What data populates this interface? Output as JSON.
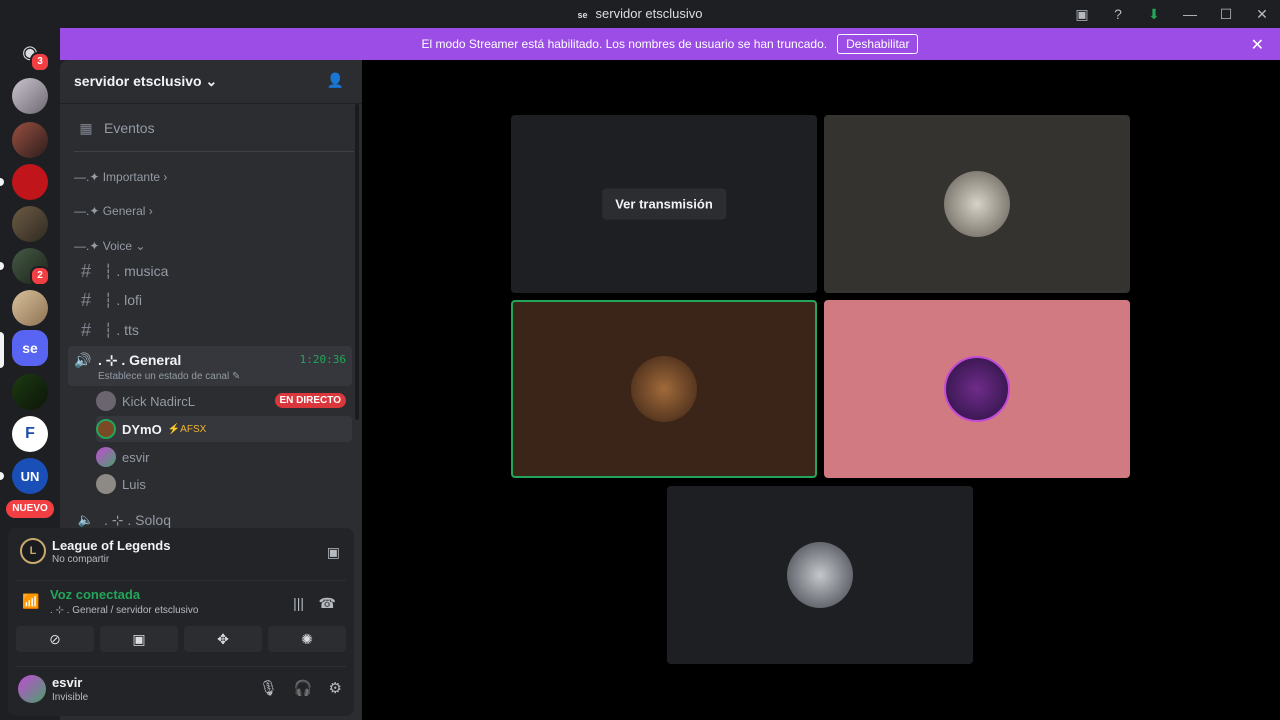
{
  "window": {
    "title": "servidor etsclusivo",
    "server_abbrev": "se"
  },
  "banner": {
    "text": "El modo Streamer está habilitado. Los nombres de usuario se han truncado.",
    "button": "Deshabilitar"
  },
  "server_bar": {
    "home_badge": "3",
    "guild_badge_2": "2",
    "current_server": "se",
    "nuevo_label": "NUEVO"
  },
  "channel_list": {
    "server_name": "servidor etsclusivo",
    "events": "Eventos",
    "categories": [
      {
        "label": "—.✦ Importante"
      },
      {
        "label": "—.✦ General"
      },
      {
        "label": "—.✦ Voice"
      }
    ],
    "channels": [
      {
        "label": "┆ . musica"
      },
      {
        "label": "┆ . lofi"
      },
      {
        "label": "┆ . tts"
      }
    ],
    "active_voice": {
      "name": ". ⊹ . General",
      "time": "1:20:36",
      "status": "Establece un estado de canal"
    },
    "voice_users": [
      {
        "name": "Kick NadircL",
        "badge": "EN DIRECTO"
      },
      {
        "name": "DYmO",
        "tag": "⚡AFSX"
      },
      {
        "name": "esvir"
      },
      {
        "name": "Luis"
      }
    ],
    "next_channel": ". ⊹ . Soloq"
  },
  "panel": {
    "game_title": "League of Legends",
    "game_sub": "No compartir",
    "voice_title": "Voz conectada",
    "voice_sub": ". ⊹ . General / servidor etsclusivo",
    "username": "esvir",
    "user_status": "Invisible"
  },
  "stage": {
    "watch_button": "Ver transmisión"
  },
  "colors": {
    "accent": "#5865f2",
    "banner": "#9b4de6",
    "green": "#23a55a",
    "red": "#da373c",
    "tile_brown": "#3b2418",
    "tile_pink": "#d17a82"
  }
}
